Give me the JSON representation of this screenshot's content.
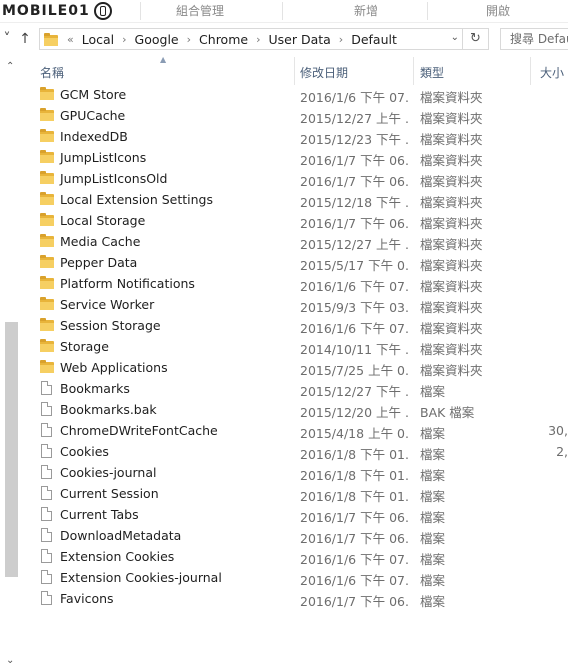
{
  "watermark": "MOBILE01",
  "ribbon": {
    "groups": [
      "組合管理",
      "新增",
      "開啟"
    ]
  },
  "nav": {
    "back_icon": "back-arrow-icon",
    "dropdown_icon": "chevron-down-icon",
    "up_icon": "up-arrow-icon"
  },
  "address": {
    "overflow": "«",
    "crumbs": [
      "Local",
      "Google",
      "Chrome",
      "User Data",
      "Default"
    ],
    "separator": "›"
  },
  "search": {
    "placeholder": "搜尋 Defau"
  },
  "columns": {
    "name": "名稱",
    "date": "修改日期",
    "type": "類型",
    "size": "大小"
  },
  "rows": [
    {
      "name": "GCM Store",
      "date": "2016/1/6 下午 07...",
      "type": "檔案資料夾",
      "size": "",
      "kind": "folder"
    },
    {
      "name": "GPUCache",
      "date": "2015/12/27 上午 ...",
      "type": "檔案資料夾",
      "size": "",
      "kind": "folder"
    },
    {
      "name": "IndexedDB",
      "date": "2015/12/23 下午 ...",
      "type": "檔案資料夾",
      "size": "",
      "kind": "folder"
    },
    {
      "name": "JumpListIcons",
      "date": "2016/1/7 下午 06...",
      "type": "檔案資料夾",
      "size": "",
      "kind": "folder"
    },
    {
      "name": "JumpListIconsOld",
      "date": "2016/1/7 下午 06...",
      "type": "檔案資料夾",
      "size": "",
      "kind": "folder"
    },
    {
      "name": "Local Extension Settings",
      "date": "2015/12/18 下午 ...",
      "type": "檔案資料夾",
      "size": "",
      "kind": "folder"
    },
    {
      "name": "Local Storage",
      "date": "2016/1/7 下午 06...",
      "type": "檔案資料夾",
      "size": "",
      "kind": "folder"
    },
    {
      "name": "Media Cache",
      "date": "2015/12/27 上午 ...",
      "type": "檔案資料夾",
      "size": "",
      "kind": "folder"
    },
    {
      "name": "Pepper Data",
      "date": "2015/5/17 下午 0...",
      "type": "檔案資料夾",
      "size": "",
      "kind": "folder"
    },
    {
      "name": "Platform Notifications",
      "date": "2016/1/6 下午 07...",
      "type": "檔案資料夾",
      "size": "",
      "kind": "folder"
    },
    {
      "name": "Service Worker",
      "date": "2015/9/3 下午 03...",
      "type": "檔案資料夾",
      "size": "",
      "kind": "folder"
    },
    {
      "name": "Session Storage",
      "date": "2016/1/6 下午 07...",
      "type": "檔案資料夾",
      "size": "",
      "kind": "folder"
    },
    {
      "name": "Storage",
      "date": "2014/10/11 下午 ...",
      "type": "檔案資料夾",
      "size": "",
      "kind": "folder"
    },
    {
      "name": "Web Applications",
      "date": "2015/7/25 上午 0...",
      "type": "檔案資料夾",
      "size": "",
      "kind": "folder"
    },
    {
      "name": "Bookmarks",
      "date": "2015/12/27 下午 ...",
      "type": "檔案",
      "size": "",
      "kind": "file"
    },
    {
      "name": "Bookmarks.bak",
      "date": "2015/12/20 上午 ...",
      "type": "BAK 檔案",
      "size": "",
      "kind": "file"
    },
    {
      "name": "ChromeDWriteFontCache",
      "date": "2015/4/18 上午 0...",
      "type": "檔案",
      "size": "30,",
      "kind": "file"
    },
    {
      "name": "Cookies",
      "date": "2016/1/8 下午 01...",
      "type": "檔案",
      "size": "2,",
      "kind": "file"
    },
    {
      "name": "Cookies-journal",
      "date": "2016/1/8 下午 01...",
      "type": "檔案",
      "size": "",
      "kind": "file"
    },
    {
      "name": "Current Session",
      "date": "2016/1/8 下午 01...",
      "type": "檔案",
      "size": "",
      "kind": "file"
    },
    {
      "name": "Current Tabs",
      "date": "2016/1/7 下午 06...",
      "type": "檔案",
      "size": "",
      "kind": "file"
    },
    {
      "name": "DownloadMetadata",
      "date": "2016/1/7 下午 06...",
      "type": "檔案",
      "size": "",
      "kind": "file"
    },
    {
      "name": "Extension Cookies",
      "date": "2016/1/6 下午 07...",
      "type": "檔案",
      "size": "",
      "kind": "file"
    },
    {
      "name": "Extension Cookies-journal",
      "date": "2016/1/6 下午 07...",
      "type": "檔案",
      "size": "",
      "kind": "file"
    },
    {
      "name": "Favicons",
      "date": "2016/1/7 下午 06...",
      "type": "檔案",
      "size": "",
      "kind": "file"
    }
  ]
}
